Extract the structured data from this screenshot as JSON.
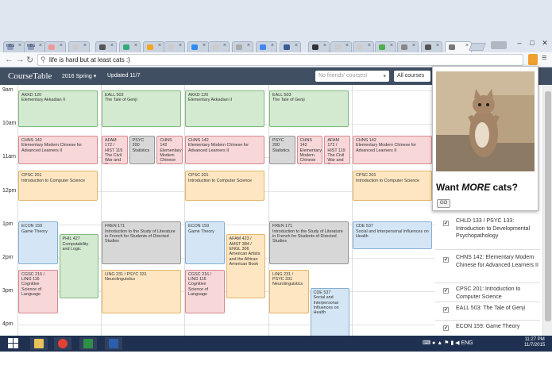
{
  "browser": {
    "tabs": [
      {
        "label": "HBS",
        "color": "#8a9bbf"
      },
      {
        "label": "HBS",
        "color": "#8a9bbf"
      },
      {
        "label": "",
        "color": "#e99"
      },
      {
        "label": "",
        "color": "#ccc"
      },
      {
        "label": "",
        "color": "#555"
      },
      {
        "label": "",
        "color": "#3a7"
      },
      {
        "label": "",
        "color": "#f5a623"
      },
      {
        "label": "",
        "color": "#ccc"
      },
      {
        "label": "",
        "color": "#2d8cf0"
      },
      {
        "label": "",
        "color": "#ccc"
      },
      {
        "label": "",
        "color": "#aaa"
      },
      {
        "label": "",
        "color": "#4285f4"
      },
      {
        "label": "",
        "color": "#3b5998"
      },
      {
        "label": "",
        "color": "#333"
      },
      {
        "label": "",
        "color": "#ccc"
      },
      {
        "label": "",
        "color": "#ccc"
      },
      {
        "label": "",
        "color": "#4caf50"
      },
      {
        "label": "",
        "color": "#888"
      },
      {
        "label": "",
        "color": "#555"
      },
      {
        "label": "",
        "color": "#777"
      }
    ],
    "address": "life is hard but at least cats :)",
    "window_buttons": [
      "–",
      "□",
      "✕"
    ]
  },
  "app": {
    "brand": "CourseTable",
    "term": "2016 Spring",
    "updated": "Updated 11/7",
    "friends_placeholder": "No friends' courses!",
    "all_courses": "All courses"
  },
  "calendar": {
    "hours": [
      "9am",
      "10am",
      "11am",
      "12pm",
      "1pm",
      "2pm",
      "3pm",
      "4pm"
    ],
    "events": [
      {
        "code": "AKKD 120",
        "title": "Elementary Akkadian II",
        "color": "green",
        "day": 0,
        "col": 0,
        "ncol": 1,
        "start": 9,
        "end": 10.1
      },
      {
        "code": "EALL 503",
        "title": "The Tale of Genji",
        "color": "green",
        "day": 1,
        "col": 0,
        "ncol": 1,
        "start": 9,
        "end": 10.1
      },
      {
        "code": "AKKD 120",
        "title": "Elementary Akkadian II",
        "color": "green",
        "day": 2,
        "col": 0,
        "ncol": 1,
        "start": 9,
        "end": 10.1
      },
      {
        "code": "EALL 503",
        "title": "The Tale of Genji",
        "color": "green",
        "day": 3,
        "col": 0,
        "ncol": 1,
        "start": 9,
        "end": 10.1
      },
      {
        "code": "CHNS 142",
        "title": "Elementary Modern Chinese for Advanced Learners II",
        "color": "pink",
        "day": 0,
        "col": 0,
        "ncol": 1,
        "start": 10.35,
        "end": 11.2
      },
      {
        "code": "AFAM 172 / HIST 119",
        "title": "The Civil War and Reconstruction",
        "color": "pink",
        "day": 1,
        "col": 0,
        "ncol": 3,
        "start": 10.35,
        "end": 11.2
      },
      {
        "code": "PSYC 200",
        "title": "Statistics",
        "color": "gray",
        "day": 1,
        "col": 1,
        "ncol": 3,
        "start": 10.35,
        "end": 11.2
      },
      {
        "code": "CHNS 142",
        "title": "Elementary Modern Chinese for Advanced Learners II",
        "color": "pink",
        "day": 1,
        "col": 2,
        "ncol": 3,
        "start": 10.35,
        "end": 11.2
      },
      {
        "code": "CHNS 142",
        "title": "Elementary Modern Chinese for Advanced Learners II",
        "color": "pink",
        "day": 2,
        "col": 0,
        "ncol": 1,
        "start": 10.35,
        "end": 11.2
      },
      {
        "code": "PSYC 200",
        "title": "Statistics",
        "color": "gray",
        "day": 3,
        "col": 0,
        "ncol": 3,
        "start": 10.35,
        "end": 11.2
      },
      {
        "code": "CHNS 142",
        "title": "Elementary Modern Chinese for Advanced Learners II",
        "color": "pink",
        "day": 3,
        "col": 1,
        "ncol": 3,
        "start": 10.35,
        "end": 11.2
      },
      {
        "code": "AFAM 172 / HIST 119",
        "title": "The Civil War and Reconstruction",
        "color": "pink",
        "day": 3,
        "col": 2,
        "ncol": 3,
        "start": 10.35,
        "end": 11.2
      },
      {
        "code": "CHNS 142",
        "title": "Elementary Modern Chinese for Advanced Learners II",
        "color": "pink",
        "day": 4,
        "col": 0,
        "ncol": 1,
        "start": 10.35,
        "end": 11.2
      },
      {
        "code": "CPSC 201",
        "title": "Introduction to Computer Science",
        "color": "orange",
        "day": 0,
        "col": 0,
        "ncol": 1,
        "start": 11.4,
        "end": 12.3
      },
      {
        "code": "CPSC 201",
        "title": "Introduction to Computer Science",
        "color": "orange",
        "day": 2,
        "col": 0,
        "ncol": 1,
        "start": 11.4,
        "end": 12.3
      },
      {
        "code": "CPSC 201",
        "title": "Introduction to Computer Science",
        "color": "orange",
        "day": 4,
        "col": 0,
        "ncol": 1,
        "start": 11.4,
        "end": 12.3
      },
      {
        "code": "ECON 159",
        "title": "Game Theory",
        "color": "blue",
        "day": 0,
        "col": 0,
        "ncol": 2,
        "start": 12.92,
        "end": 14.2
      },
      {
        "code": "PHIL 427",
        "title": "Computability and Logic",
        "color": "green",
        "day": 0,
        "col": 1,
        "ncol": 2,
        "start": 13.3,
        "end": 15.2
      },
      {
        "code": "CGSC 216 / LING 116",
        "title": "Cognitive Science of Language",
        "color": "pink",
        "day": 0,
        "col": 0,
        "ncol": 2,
        "start": 14.35,
        "end": 15.65
      },
      {
        "code": "FREN 171",
        "title": "Introduction to the Study of Literature in French for Students of Directed Studies",
        "color": "gray",
        "day": 1,
        "col": 0,
        "ncol": 1,
        "start": 12.92,
        "end": 14.2
      },
      {
        "code": "LING 231 / PSYC 331",
        "title": "Neurolinguistics",
        "color": "orange",
        "day": 1,
        "col": 0,
        "ncol": 1,
        "start": 14.35,
        "end": 15.65
      },
      {
        "code": "ECON 159",
        "title": "Game Theory",
        "color": "blue",
        "day": 2,
        "col": 0,
        "ncol": 2,
        "start": 12.92,
        "end": 14.2
      },
      {
        "code": "AFAM 423 / AMST 384 / ENGL 306",
        "title": "American Artists and the African American Book",
        "color": "orange",
        "day": 2,
        "col": 1,
        "ncol": 2,
        "start": 13.3,
        "end": 15.2
      },
      {
        "code": "CGSC 216 / LING 116",
        "title": "Cognitive Science of Language",
        "color": "pink",
        "day": 2,
        "col": 0,
        "ncol": 2,
        "start": 14.35,
        "end": 15.65
      },
      {
        "code": "FREN 171",
        "title": "Introduction to the Study of Literature in French for Students of Directed Studies",
        "color": "gray",
        "day": 3,
        "col": 0,
        "ncol": 1,
        "start": 12.92,
        "end": 14.2
      },
      {
        "code": "LING 231 / PSYC 331",
        "title": "Neurolinguistics",
        "color": "orange",
        "day": 3,
        "col": 0,
        "ncol": 2,
        "start": 14.35,
        "end": 15.65
      },
      {
        "code": "CDE 537",
        "title": "Social and Interpersonal Influences on Health",
        "color": "blue",
        "day": 3,
        "col": 1,
        "ncol": 2,
        "start": 14.9,
        "end": 16.55
      },
      {
        "code": "CDE 537",
        "title": "Social and Interpersonal Influences on Health",
        "color": "blue",
        "day": 4,
        "col": 0,
        "ncol": 1,
        "start": 12.92,
        "end": 13.75
      }
    ]
  },
  "popup": {
    "title_pre": "Want ",
    "title_em": "MORE",
    "title_post": " cats?",
    "button": "GO"
  },
  "sidebar": {
    "items": [
      {
        "label": "CHLD 133 / PSYC 133: Introduction to Developmental Psychopathology",
        "checked": "✔"
      },
      {
        "label": "CHNS 142: Elementary Modern Chinese for Advanced Learners II",
        "checked": "✔"
      },
      {
        "label": "CPSC 201: Introduction to Computer Science",
        "checked": "✔"
      },
      {
        "label": "EALL 503: The Tale of Genji",
        "checked": "✔"
      },
      {
        "label": "ECON 159: Game Theory",
        "checked": "✔"
      }
    ]
  },
  "taskbar": {
    "lang": "ENG",
    "time": "11:27 PM",
    "date": "11/7/2015",
    "apps": [
      {
        "name": "windows-start",
        "color": "#fff"
      },
      {
        "name": "file-explorer",
        "color": "#e8c35a"
      },
      {
        "name": "chrome",
        "color": "#e34133"
      },
      {
        "name": "store",
        "color": "#2f8f46"
      },
      {
        "name": "word",
        "color": "#2b5fad"
      }
    ]
  }
}
